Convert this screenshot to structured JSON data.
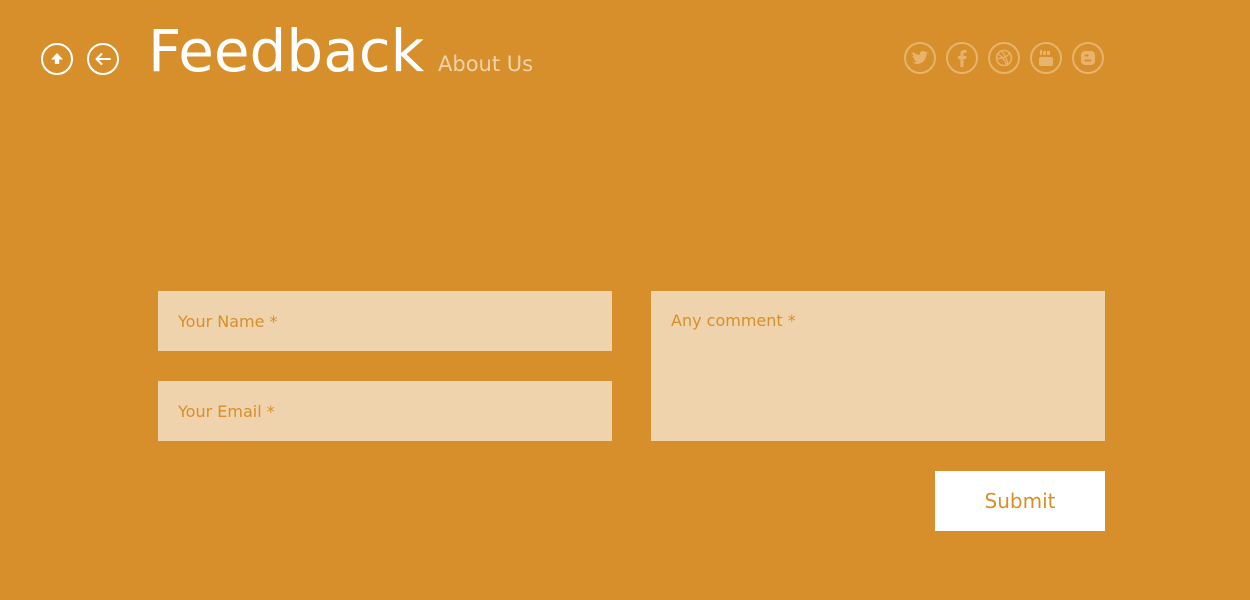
{
  "header": {
    "title": "Feedback",
    "about_link": "About Us",
    "nav_icons": [
      "home-up-arrow-icon",
      "back-arrow-icon"
    ],
    "social_icons": [
      "twitter-icon",
      "facebook-icon",
      "dribbble-icon",
      "youtube-icon",
      "blogger-icon"
    ]
  },
  "form": {
    "name_placeholder": "Your Name *",
    "email_placeholder": "Your Email *",
    "comment_placeholder": "Any comment *",
    "submit_label": "Submit"
  },
  "colors": {
    "background": "#d68f2b",
    "field_bg": "#efd3ac",
    "button_bg": "#ffffff",
    "accent_text": "#d68f2b",
    "muted_text": "#f2d2a8"
  }
}
